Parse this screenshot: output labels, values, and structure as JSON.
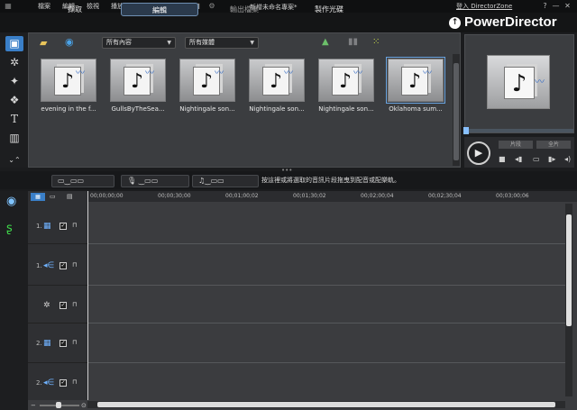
{
  "menu": [
    "檔案",
    "編輯",
    "檢視",
    "播放"
  ],
  "project_title": "新增未命名專案*",
  "login_link": "登入 DirectorZone",
  "window_controls": [
    "?",
    "—",
    "✕"
  ],
  "tabs": [
    {
      "label": "擷取"
    },
    {
      "label": "編輯",
      "active": true
    },
    {
      "label": "輸出檔案"
    },
    {
      "label": "製作光碟"
    }
  ],
  "logo": "PowerDirector",
  "library": {
    "filter_content": "所有內容",
    "filter_media": "所有媒體",
    "clips": [
      {
        "name": "evening in the f..."
      },
      {
        "name": "GullsByTheSea..."
      },
      {
        "name": "Nightingale son..."
      },
      {
        "name": "Nightingale son..."
      },
      {
        "name": "Nightingale son..."
      },
      {
        "name": "Oklahoma sum...",
        "selected": true
      }
    ]
  },
  "preview": {
    "mode_clip": "片段",
    "mode_movie": "全片"
  },
  "hint": "按這裡或將選取的音訊片段拖曳到配音或配樂軌。",
  "ruler": [
    "00;00;00;00",
    "00;00;30;00",
    "00;01;00;02",
    "00;01;30;02",
    "00;02;00;04",
    "00;02;30;04",
    "00;03;00;06"
  ],
  "lanes": [
    {
      "num": "1.",
      "icon": "▦"
    },
    {
      "num": "1.",
      "icon": "◂∈"
    },
    {
      "num": "",
      "icon": "✲"
    },
    {
      "num": "2.",
      "icon": "▦"
    },
    {
      "num": "2.",
      "icon": "◂∈"
    }
  ],
  "icons": {
    "play": "▶",
    "stop": "■",
    "music_note": "♪",
    "lock": "🔓"
  }
}
